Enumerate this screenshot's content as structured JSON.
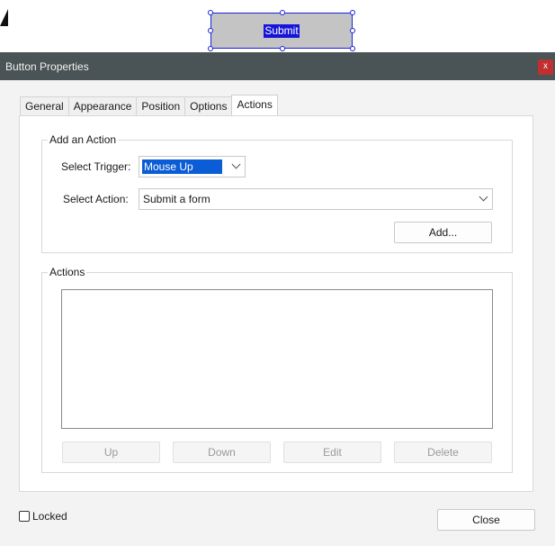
{
  "canvas": {
    "form_button_label": "Submit"
  },
  "dialog": {
    "title": "Button Properties",
    "close_glyph": "x",
    "tabs": [
      {
        "label": "General",
        "active": false
      },
      {
        "label": "Appearance",
        "active": false
      },
      {
        "label": "Position",
        "active": false
      },
      {
        "label": "Options",
        "active": false
      },
      {
        "label": "Actions",
        "active": true
      }
    ],
    "add_action": {
      "legend": "Add an Action",
      "trigger_label": "Select Trigger:",
      "trigger_value": "Mouse Up",
      "action_label": "Select Action:",
      "action_value": "Submit a form",
      "add_button": "Add..."
    },
    "actions": {
      "legend": "Actions",
      "items": [],
      "buttons": {
        "up": "Up",
        "down": "Down",
        "edit": "Edit",
        "delete": "Delete"
      }
    },
    "locked_label": "Locked",
    "locked_checked": false,
    "close_button": "Close"
  },
  "colors": {
    "titlebar": "#4a5355",
    "selection": "#0b5cd7",
    "form_button_border": "#1a22e0",
    "close_x_bg": "#c03030"
  },
  "icons": {
    "dropdown": "chevron-down-icon",
    "close": "close-icon"
  }
}
